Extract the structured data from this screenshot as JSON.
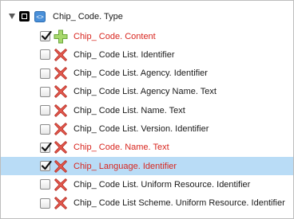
{
  "tree": {
    "root": {
      "label": "Chip_ Code. Type",
      "expanded": true,
      "checkbox_state": "indeterminate",
      "icon": "schema-type-icon"
    },
    "children": [
      {
        "label": "Chip_ Code. Content",
        "checked": true,
        "icon": "plus-icon",
        "highlight_red": true,
        "selected": false
      },
      {
        "label": "Chip_ Code List. Identifier",
        "checked": false,
        "icon": "x-icon",
        "highlight_red": false,
        "selected": false
      },
      {
        "label": "Chip_ Code List. Agency. Identifier",
        "checked": false,
        "icon": "x-icon",
        "highlight_red": false,
        "selected": false
      },
      {
        "label": "Chip_ Code List. Agency Name. Text",
        "checked": false,
        "icon": "x-icon",
        "highlight_red": false,
        "selected": false
      },
      {
        "label": "Chip_ Code List. Name. Text",
        "checked": false,
        "icon": "x-icon",
        "highlight_red": false,
        "selected": false
      },
      {
        "label": "Chip_ Code List. Version. Identifier",
        "checked": false,
        "icon": "x-icon",
        "highlight_red": false,
        "selected": false
      },
      {
        "label": "Chip_ Code. Name. Text",
        "checked": true,
        "icon": "x-icon",
        "highlight_red": true,
        "selected": false
      },
      {
        "label": "Chip_ Language. Identifier",
        "checked": true,
        "icon": "x-icon",
        "highlight_red": true,
        "selected": true
      },
      {
        "label": "Chip_ Code List. Uniform Resource. Identifier",
        "checked": false,
        "icon": "x-icon",
        "highlight_red": false,
        "selected": false
      },
      {
        "label": "Chip_ Code List Scheme. Uniform Resource. Identifier",
        "checked": false,
        "icon": "x-icon",
        "highlight_red": false,
        "selected": false
      }
    ]
  },
  "colors": {
    "selected_row": "#b9dcf6",
    "red_text": "#d8261f"
  }
}
